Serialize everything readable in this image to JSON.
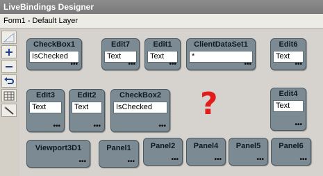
{
  "window": {
    "title": "LiveBindings Designer"
  },
  "layer": {
    "label": "Form1  - Default Layer"
  },
  "toolbar": {
    "icons": [
      "zoom-diagonal-icon",
      "zoom-in-icon",
      "zoom-out-icon",
      "undo-icon",
      "grid-icon",
      "wand-icon"
    ]
  },
  "nodes": {
    "checkbox1": {
      "title": "CheckBox1",
      "field": "IsChecked",
      "more": "•••"
    },
    "edit7": {
      "title": "Edit7",
      "field": "Text",
      "more": "•••"
    },
    "edit1": {
      "title": "Edit1",
      "field": "Text",
      "more": "•••"
    },
    "clientdataset1": {
      "title": "ClientDataSet1",
      "field": "*",
      "more": "•••"
    },
    "edit6": {
      "title": "Edit6",
      "field": "Text",
      "more": "•••"
    },
    "edit3": {
      "title": "Edit3",
      "field": "Text",
      "more": "•••"
    },
    "edit2": {
      "title": "Edit2",
      "field": "Text",
      "more": "•••"
    },
    "checkbox2": {
      "title": "CheckBox2",
      "field": "IsChecked",
      "more": "•••"
    },
    "edit4": {
      "title": "Edit4",
      "field": "Text",
      "more": "•••"
    },
    "viewport3d1": {
      "title": "Viewport3D1",
      "more": "•••"
    },
    "panel1": {
      "title": "Panel1",
      "more": "•••"
    },
    "panel2": {
      "title": "Panel2",
      "more": "•••"
    },
    "panel4": {
      "title": "Panel4",
      "more": "•••"
    },
    "panel5": {
      "title": "Panel5",
      "more": "•••"
    },
    "panel6": {
      "title": "Panel6",
      "more": "•••"
    }
  },
  "overlay": {
    "question_mark": "?",
    "color": "#e21b1b"
  }
}
